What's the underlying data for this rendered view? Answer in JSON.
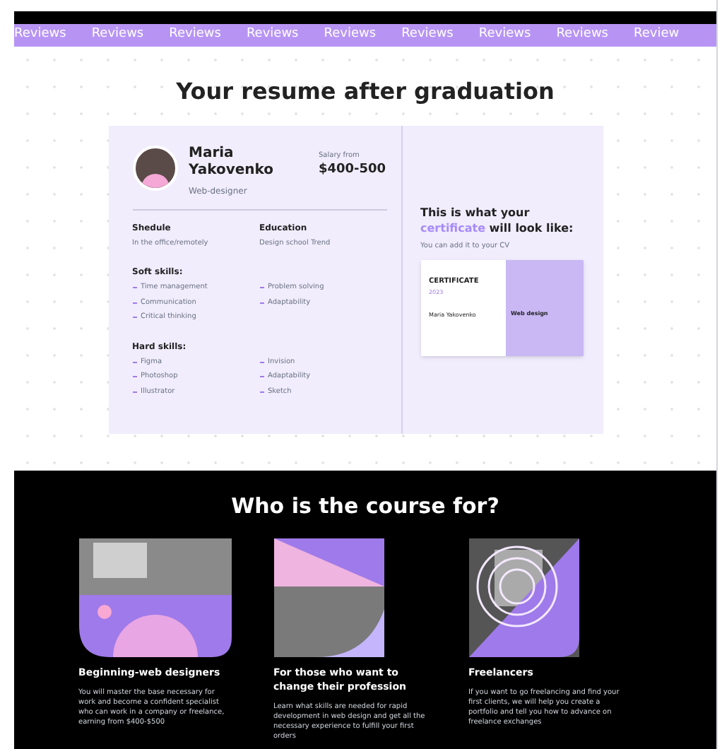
{
  "marquee": [
    "Reviews",
    "Reviews",
    "Reviews",
    "Reviews",
    "Reviews",
    "Reviews",
    "Reviews",
    "Reviews",
    "Review"
  ],
  "resume": {
    "title": "Your resume after graduation",
    "name": "Maria Yakovenko",
    "role": "Web-designer",
    "salary_label": "Salary from",
    "salary": "$400-500",
    "facts": [
      {
        "label": "Shedule",
        "value": "In the office/remotely"
      },
      {
        "label": "Education",
        "value": "Design school Trend"
      }
    ],
    "skill_groups": [
      {
        "title": "Soft skills:",
        "columns": [
          [
            "Time management",
            "Communication",
            "Critical thinking"
          ],
          [
            "Problem solving",
            "Adaptability"
          ]
        ]
      },
      {
        "title": "Hard skills:",
        "columns": [
          [
            "Figma",
            "Photoshop",
            "Illustrator"
          ],
          [
            "Invision",
            "Adaptability",
            "Sketch"
          ]
        ]
      }
    ],
    "certificate": {
      "heading": "This is what your **certificate** will look like:",
      "note": "You can add it to your CV",
      "cert_title": "CERTIFICATE",
      "year": "2023",
      "holder": "Maria Yakovenko",
      "course": "Web design"
    }
  },
  "audience": {
    "title": "Who is the course for?",
    "cards": [
      {
        "kind": "circles",
        "title": "Beginning-web designers",
        "text": "You will master the base necessary for work and become a confident specialist who can work in a company or freelance, earning from $400-$500"
      },
      {
        "kind": "wedge",
        "title": "For those who want to change their profession",
        "text": "Learn what skills are needed for rapid development in web design and get all the necessary experience to fulfill your first orders"
      },
      {
        "kind": "rings",
        "title": "Freelancers",
        "text": "If you want to go freelancing and find your first clients, we will help you create a portfolio and tell you how to advance on freelance exchanges"
      }
    ]
  }
}
